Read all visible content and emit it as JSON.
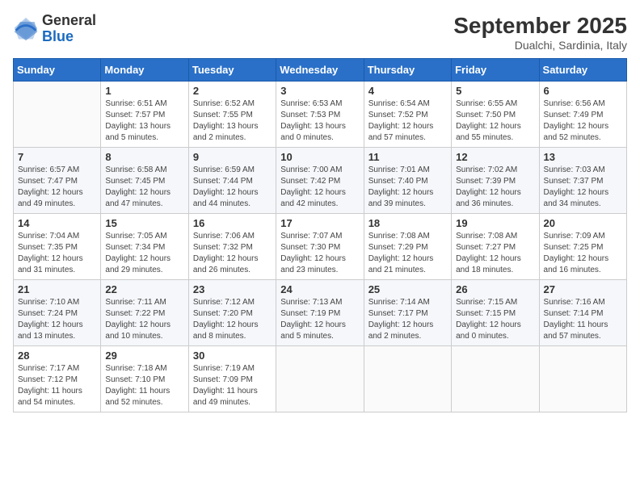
{
  "header": {
    "logo_general": "General",
    "logo_blue": "Blue",
    "month": "September 2025",
    "location": "Dualchi, Sardinia, Italy"
  },
  "columns": [
    "Sunday",
    "Monday",
    "Tuesday",
    "Wednesday",
    "Thursday",
    "Friday",
    "Saturday"
  ],
  "weeks": [
    [
      {
        "day": "",
        "info": ""
      },
      {
        "day": "1",
        "info": "Sunrise: 6:51 AM\nSunset: 7:57 PM\nDaylight: 13 hours\nand 5 minutes."
      },
      {
        "day": "2",
        "info": "Sunrise: 6:52 AM\nSunset: 7:55 PM\nDaylight: 13 hours\nand 2 minutes."
      },
      {
        "day": "3",
        "info": "Sunrise: 6:53 AM\nSunset: 7:53 PM\nDaylight: 13 hours\nand 0 minutes."
      },
      {
        "day": "4",
        "info": "Sunrise: 6:54 AM\nSunset: 7:52 PM\nDaylight: 12 hours\nand 57 minutes."
      },
      {
        "day": "5",
        "info": "Sunrise: 6:55 AM\nSunset: 7:50 PM\nDaylight: 12 hours\nand 55 minutes."
      },
      {
        "day": "6",
        "info": "Sunrise: 6:56 AM\nSunset: 7:49 PM\nDaylight: 12 hours\nand 52 minutes."
      }
    ],
    [
      {
        "day": "7",
        "info": "Sunrise: 6:57 AM\nSunset: 7:47 PM\nDaylight: 12 hours\nand 49 minutes."
      },
      {
        "day": "8",
        "info": "Sunrise: 6:58 AM\nSunset: 7:45 PM\nDaylight: 12 hours\nand 47 minutes."
      },
      {
        "day": "9",
        "info": "Sunrise: 6:59 AM\nSunset: 7:44 PM\nDaylight: 12 hours\nand 44 minutes."
      },
      {
        "day": "10",
        "info": "Sunrise: 7:00 AM\nSunset: 7:42 PM\nDaylight: 12 hours\nand 42 minutes."
      },
      {
        "day": "11",
        "info": "Sunrise: 7:01 AM\nSunset: 7:40 PM\nDaylight: 12 hours\nand 39 minutes."
      },
      {
        "day": "12",
        "info": "Sunrise: 7:02 AM\nSunset: 7:39 PM\nDaylight: 12 hours\nand 36 minutes."
      },
      {
        "day": "13",
        "info": "Sunrise: 7:03 AM\nSunset: 7:37 PM\nDaylight: 12 hours\nand 34 minutes."
      }
    ],
    [
      {
        "day": "14",
        "info": "Sunrise: 7:04 AM\nSunset: 7:35 PM\nDaylight: 12 hours\nand 31 minutes."
      },
      {
        "day": "15",
        "info": "Sunrise: 7:05 AM\nSunset: 7:34 PM\nDaylight: 12 hours\nand 29 minutes."
      },
      {
        "day": "16",
        "info": "Sunrise: 7:06 AM\nSunset: 7:32 PM\nDaylight: 12 hours\nand 26 minutes."
      },
      {
        "day": "17",
        "info": "Sunrise: 7:07 AM\nSunset: 7:30 PM\nDaylight: 12 hours\nand 23 minutes."
      },
      {
        "day": "18",
        "info": "Sunrise: 7:08 AM\nSunset: 7:29 PM\nDaylight: 12 hours\nand 21 minutes."
      },
      {
        "day": "19",
        "info": "Sunrise: 7:08 AM\nSunset: 7:27 PM\nDaylight: 12 hours\nand 18 minutes."
      },
      {
        "day": "20",
        "info": "Sunrise: 7:09 AM\nSunset: 7:25 PM\nDaylight: 12 hours\nand 16 minutes."
      }
    ],
    [
      {
        "day": "21",
        "info": "Sunrise: 7:10 AM\nSunset: 7:24 PM\nDaylight: 12 hours\nand 13 minutes."
      },
      {
        "day": "22",
        "info": "Sunrise: 7:11 AM\nSunset: 7:22 PM\nDaylight: 12 hours\nand 10 minutes."
      },
      {
        "day": "23",
        "info": "Sunrise: 7:12 AM\nSunset: 7:20 PM\nDaylight: 12 hours\nand 8 minutes."
      },
      {
        "day": "24",
        "info": "Sunrise: 7:13 AM\nSunset: 7:19 PM\nDaylight: 12 hours\nand 5 minutes."
      },
      {
        "day": "25",
        "info": "Sunrise: 7:14 AM\nSunset: 7:17 PM\nDaylight: 12 hours\nand 2 minutes."
      },
      {
        "day": "26",
        "info": "Sunrise: 7:15 AM\nSunset: 7:15 PM\nDaylight: 12 hours\nand 0 minutes."
      },
      {
        "day": "27",
        "info": "Sunrise: 7:16 AM\nSunset: 7:14 PM\nDaylight: 11 hours\nand 57 minutes."
      }
    ],
    [
      {
        "day": "28",
        "info": "Sunrise: 7:17 AM\nSunset: 7:12 PM\nDaylight: 11 hours\nand 54 minutes."
      },
      {
        "day": "29",
        "info": "Sunrise: 7:18 AM\nSunset: 7:10 PM\nDaylight: 11 hours\nand 52 minutes."
      },
      {
        "day": "30",
        "info": "Sunrise: 7:19 AM\nSunset: 7:09 PM\nDaylight: 11 hours\nand 49 minutes."
      },
      {
        "day": "",
        "info": ""
      },
      {
        "day": "",
        "info": ""
      },
      {
        "day": "",
        "info": ""
      },
      {
        "day": "",
        "info": ""
      }
    ]
  ]
}
